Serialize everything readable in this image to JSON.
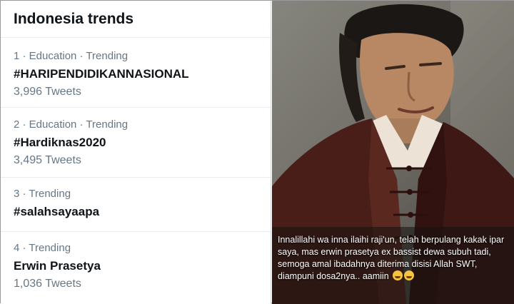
{
  "trends": {
    "title": "Indonesia trends",
    "items": [
      {
        "meta": "1 · Education · Trending",
        "name": "#HARIPENDIDIKANNASIONAL",
        "count": "3,996 Tweets"
      },
      {
        "meta": "2 · Education · Trending",
        "name": "#Hardiknas2020",
        "count": "3,495 Tweets"
      },
      {
        "meta": "3 · Trending",
        "name": "#salahsayaapa",
        "count": ""
      },
      {
        "meta": "4 · Trending",
        "name": "Erwin Prasetya",
        "count": "1,036 Tweets"
      }
    ]
  },
  "photo": {
    "caption": "Innalillahi wa inna ilaihi raji'un, telah berpulang kakak ipar saya, mas erwin prasetya ex bassist dewa subuh tadi, semoga amal ibadahnya diterima disisi Allah SWT, diampuni dosa2nya.. aamiin",
    "emoji_icons": [
      "crying-face-icon",
      "weary-face-icon"
    ]
  }
}
